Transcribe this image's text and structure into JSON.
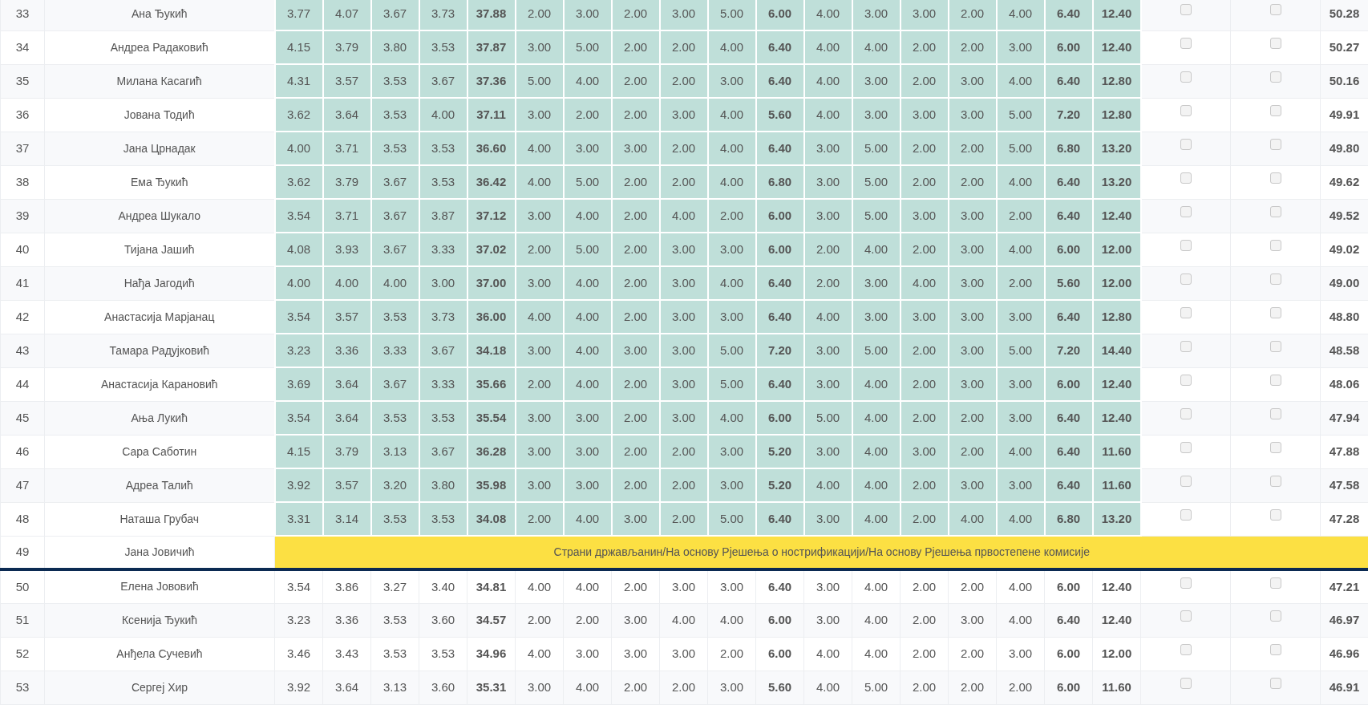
{
  "rows": [
    {
      "kind": "score",
      "number": "33",
      "name": "Ана Ђукић",
      "highlighted": true,
      "scores": [
        "3.77",
        "4.07",
        "3.67",
        "3.73",
        "37.88",
        "2.00",
        "3.00",
        "2.00",
        "3.00",
        "5.00",
        "6.00",
        "4.00",
        "3.00",
        "3.00",
        "2.00",
        "4.00",
        "6.40",
        "12.40"
      ],
      "checks": [
        false,
        false
      ],
      "total": "50.28"
    },
    {
      "kind": "score",
      "number": "34",
      "name": "Андреа Радаковић",
      "highlighted": true,
      "scores": [
        "4.15",
        "3.79",
        "3.80",
        "3.53",
        "37.87",
        "3.00",
        "5.00",
        "2.00",
        "2.00",
        "4.00",
        "6.40",
        "4.00",
        "4.00",
        "2.00",
        "2.00",
        "3.00",
        "6.00",
        "12.40"
      ],
      "checks": [
        false,
        false
      ],
      "total": "50.27"
    },
    {
      "kind": "score",
      "number": "35",
      "name": "Милана Касагић",
      "highlighted": true,
      "scores": [
        "4.31",
        "3.57",
        "3.53",
        "3.67",
        "37.36",
        "5.00",
        "4.00",
        "2.00",
        "2.00",
        "3.00",
        "6.40",
        "4.00",
        "3.00",
        "2.00",
        "3.00",
        "4.00",
        "6.40",
        "12.80"
      ],
      "checks": [
        false,
        false
      ],
      "total": "50.16"
    },
    {
      "kind": "score",
      "number": "36",
      "name": "Јована Тодић",
      "highlighted": true,
      "scores": [
        "3.62",
        "3.64",
        "3.53",
        "4.00",
        "37.11",
        "3.00",
        "2.00",
        "2.00",
        "3.00",
        "4.00",
        "5.60",
        "4.00",
        "3.00",
        "3.00",
        "3.00",
        "5.00",
        "7.20",
        "12.80"
      ],
      "checks": [
        false,
        false
      ],
      "total": "49.91"
    },
    {
      "kind": "score",
      "number": "37",
      "name": "Јана Црнадак",
      "highlighted": true,
      "scores": [
        "4.00",
        "3.71",
        "3.53",
        "3.53",
        "36.60",
        "4.00",
        "3.00",
        "3.00",
        "2.00",
        "4.00",
        "6.40",
        "3.00",
        "5.00",
        "2.00",
        "2.00",
        "5.00",
        "6.80",
        "13.20"
      ],
      "checks": [
        false,
        false
      ],
      "total": "49.80"
    },
    {
      "kind": "score",
      "number": "38",
      "name": "Ема Ђукић",
      "highlighted": true,
      "scores": [
        "3.62",
        "3.79",
        "3.67",
        "3.53",
        "36.42",
        "4.00",
        "5.00",
        "2.00",
        "2.00",
        "4.00",
        "6.80",
        "3.00",
        "5.00",
        "2.00",
        "2.00",
        "4.00",
        "6.40",
        "13.20"
      ],
      "checks": [
        false,
        false
      ],
      "total": "49.62"
    },
    {
      "kind": "score",
      "number": "39",
      "name": "Андреа Шукало",
      "highlighted": true,
      "scores": [
        "3.54",
        "3.71",
        "3.67",
        "3.87",
        "37.12",
        "3.00",
        "4.00",
        "2.00",
        "4.00",
        "2.00",
        "6.00",
        "3.00",
        "5.00",
        "3.00",
        "3.00",
        "2.00",
        "6.40",
        "12.40"
      ],
      "checks": [
        false,
        false
      ],
      "total": "49.52"
    },
    {
      "kind": "score",
      "number": "40",
      "name": "Тијана Јашић",
      "highlighted": true,
      "scores": [
        "4.08",
        "3.93",
        "3.67",
        "3.33",
        "37.02",
        "2.00",
        "5.00",
        "2.00",
        "3.00",
        "3.00",
        "6.00",
        "2.00",
        "4.00",
        "2.00",
        "3.00",
        "4.00",
        "6.00",
        "12.00"
      ],
      "checks": [
        false,
        false
      ],
      "total": "49.02"
    },
    {
      "kind": "score",
      "number": "41",
      "name": "Нађа Јагодић",
      "highlighted": true,
      "scores": [
        "4.00",
        "4.00",
        "4.00",
        "3.00",
        "37.00",
        "3.00",
        "4.00",
        "2.00",
        "3.00",
        "4.00",
        "6.40",
        "2.00",
        "3.00",
        "4.00",
        "3.00",
        "2.00",
        "5.60",
        "12.00"
      ],
      "checks": [
        false,
        false
      ],
      "total": "49.00"
    },
    {
      "kind": "score",
      "number": "42",
      "name": "Анастасија Марјанац",
      "highlighted": true,
      "scores": [
        "3.54",
        "3.57",
        "3.53",
        "3.73",
        "36.00",
        "4.00",
        "4.00",
        "2.00",
        "3.00",
        "3.00",
        "6.40",
        "4.00",
        "3.00",
        "3.00",
        "3.00",
        "3.00",
        "6.40",
        "12.80"
      ],
      "checks": [
        false,
        false
      ],
      "total": "48.80"
    },
    {
      "kind": "score",
      "number": "43",
      "name": "Тамара Радујковић",
      "highlighted": true,
      "scores": [
        "3.23",
        "3.36",
        "3.33",
        "3.67",
        "34.18",
        "3.00",
        "4.00",
        "3.00",
        "3.00",
        "5.00",
        "7.20",
        "3.00",
        "5.00",
        "2.00",
        "3.00",
        "5.00",
        "7.20",
        "14.40"
      ],
      "checks": [
        false,
        false
      ],
      "total": "48.58"
    },
    {
      "kind": "score",
      "number": "44",
      "name": "Анастасија Карановић",
      "highlighted": true,
      "scores": [
        "3.69",
        "3.64",
        "3.67",
        "3.33",
        "35.66",
        "2.00",
        "4.00",
        "2.00",
        "3.00",
        "5.00",
        "6.40",
        "3.00",
        "4.00",
        "2.00",
        "3.00",
        "3.00",
        "6.00",
        "12.40"
      ],
      "checks": [
        false,
        false
      ],
      "total": "48.06"
    },
    {
      "kind": "score",
      "number": "45",
      "name": "Ања Лукић",
      "highlighted": true,
      "scores": [
        "3.54",
        "3.64",
        "3.53",
        "3.53",
        "35.54",
        "3.00",
        "3.00",
        "2.00",
        "3.00",
        "4.00",
        "6.00",
        "5.00",
        "4.00",
        "2.00",
        "2.00",
        "3.00",
        "6.40",
        "12.40"
      ],
      "checks": [
        false,
        false
      ],
      "total": "47.94"
    },
    {
      "kind": "score",
      "number": "46",
      "name": "Сара Саботин",
      "highlighted": true,
      "scores": [
        "4.15",
        "3.79",
        "3.13",
        "3.67",
        "36.28",
        "3.00",
        "3.00",
        "2.00",
        "2.00",
        "3.00",
        "5.20",
        "3.00",
        "4.00",
        "3.00",
        "2.00",
        "4.00",
        "6.40",
        "11.60"
      ],
      "checks": [
        false,
        false
      ],
      "total": "47.88"
    },
    {
      "kind": "score",
      "number": "47",
      "name": "Адреа Талић",
      "highlighted": true,
      "scores": [
        "3.92",
        "3.57",
        "3.20",
        "3.80",
        "35.98",
        "3.00",
        "3.00",
        "2.00",
        "2.00",
        "3.00",
        "5.20",
        "4.00",
        "4.00",
        "2.00",
        "3.00",
        "3.00",
        "6.40",
        "11.60"
      ],
      "checks": [
        false,
        false
      ],
      "total": "47.58"
    },
    {
      "kind": "score",
      "number": "48",
      "name": "Наташа Грубач",
      "highlighted": true,
      "scores": [
        "3.31",
        "3.14",
        "3.53",
        "3.53",
        "34.08",
        "2.00",
        "4.00",
        "3.00",
        "2.00",
        "5.00",
        "6.40",
        "3.00",
        "4.00",
        "2.00",
        "4.00",
        "4.00",
        "6.80",
        "13.20"
      ],
      "checks": [
        false,
        false
      ],
      "total": "47.28"
    },
    {
      "kind": "notice",
      "number": "49",
      "name": "Јана Јовичић",
      "notice": "Страни држављанин/На основу Рјешења о нострификацији/На основу Рјешења првостепене комисије"
    },
    {
      "kind": "score",
      "number": "50",
      "name": "Елена Јововић",
      "highlighted": false,
      "scores": [
        "3.54",
        "3.86",
        "3.27",
        "3.40",
        "34.81",
        "4.00",
        "4.00",
        "2.00",
        "3.00",
        "3.00",
        "6.40",
        "3.00",
        "4.00",
        "2.00",
        "2.00",
        "4.00",
        "6.00",
        "12.40"
      ],
      "checks": [
        false,
        false
      ],
      "total": "47.21"
    },
    {
      "kind": "score",
      "number": "51",
      "name": "Ксенија Ђукић",
      "highlighted": false,
      "scores": [
        "3.23",
        "3.36",
        "3.53",
        "3.60",
        "34.57",
        "2.00",
        "2.00",
        "3.00",
        "4.00",
        "4.00",
        "6.00",
        "3.00",
        "4.00",
        "2.00",
        "3.00",
        "4.00",
        "6.40",
        "12.40"
      ],
      "checks": [
        false,
        false
      ],
      "total": "46.97"
    },
    {
      "kind": "score",
      "number": "52",
      "name": "Анђела Сучевић",
      "highlighted": false,
      "scores": [
        "3.46",
        "3.43",
        "3.53",
        "3.53",
        "34.96",
        "4.00",
        "3.00",
        "3.00",
        "3.00",
        "2.00",
        "6.00",
        "4.00",
        "4.00",
        "2.00",
        "2.00",
        "3.00",
        "6.00",
        "12.00"
      ],
      "checks": [
        false,
        false
      ],
      "total": "46.96"
    },
    {
      "kind": "score",
      "number": "53",
      "name": "Сергеј Хир",
      "highlighted": false,
      "scores": [
        "3.92",
        "3.64",
        "3.13",
        "3.60",
        "35.31",
        "3.00",
        "4.00",
        "2.00",
        "2.00",
        "3.00",
        "5.60",
        "4.00",
        "5.00",
        "2.00",
        "2.00",
        "2.00",
        "6.00",
        "11.60"
      ],
      "checks": [
        false,
        false
      ],
      "total": "46.91"
    }
  ]
}
